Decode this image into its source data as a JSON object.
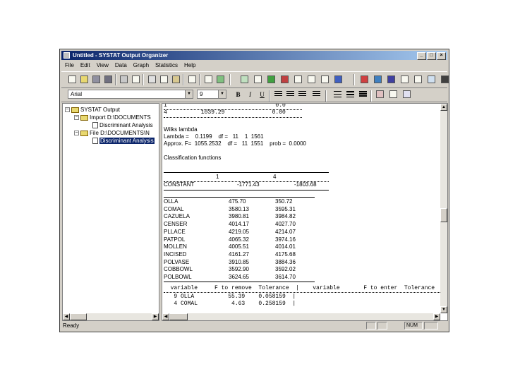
{
  "window": {
    "title": "Untitled - SYSTAT Output Organizer",
    "title_buttons": [
      "_",
      "□",
      "×"
    ]
  },
  "menubar": [
    "File",
    "Edit",
    "View",
    "Data",
    "Graph",
    "Statistics",
    "Help"
  ],
  "format_bar": {
    "font": "Arial",
    "size": "9",
    "bold": "B",
    "italic": "I",
    "underline": "U"
  },
  "tree": {
    "root": "SYSTAT Output",
    "nodes": [
      {
        "label": "Import D:\\DOCUMENTS",
        "child": "Discriminant Analysis"
      },
      {
        "label": "File D:\\DOCUMENTS\\N",
        "child": "Discriminant Analysis"
      }
    ]
  },
  "output": {
    "top_row_1": "1                                0.0",
    "top_row_2": "4          1039.29              0.00",
    "wilks_title": "Wilks lambda",
    "wilks_line1": "Lambda =    0.1199    df =   11    1  1561",
    "wilks_line2": "Approx. F=  1055.2532    df =   11  1551    prob =  0.0000",
    "classification_title": "Classification functions",
    "class_headers": [
      "1",
      "4"
    ],
    "constant_row": {
      "label": "CONSTANT",
      "v1": "-1771.43",
      "v2": "-1803.68"
    },
    "functions": [
      {
        "label": "OLLA",
        "v1": "475.70",
        "v2": "350.72"
      },
      {
        "label": "COMAL",
        "v1": "3580.13",
        "v2": "3595.31"
      },
      {
        "label": "CAZUELA",
        "v1": "3980.81",
        "v2": "3984.82"
      },
      {
        "label": "CENSER",
        "v1": "4014.17",
        "v2": "4027.70"
      },
      {
        "label": "PLLACE",
        "v1": "4219.05",
        "v2": "4214.07"
      },
      {
        "label": "PATPOL",
        "v1": "4065.32",
        "v2": "3974.16"
      },
      {
        "label": "MOLLEN",
        "v1": "4005.51",
        "v2": "4014.01"
      },
      {
        "label": "INCISED",
        "v1": "4161.27",
        "v2": "4175.68"
      },
      {
        "label": "POLVASE",
        "v1": "3910.85",
        "v2": "3884.36"
      },
      {
        "label": "COBBOWL",
        "v1": "3592.90",
        "v2": "3592.02"
      },
      {
        "label": "POLBOWL",
        "v1": "3624.65",
        "v2": "3614.70"
      }
    ],
    "var_table_header": "  variable     F to remove  Tolerance  |    variable       F to enter  Tolerance",
    "var_rows": [
      "   9 OLLA          55.39    0.058159  |",
      "   4 COMAL          4.63    0.258159  |"
    ]
  },
  "status": {
    "text": "Ready",
    "num": "NUM"
  }
}
